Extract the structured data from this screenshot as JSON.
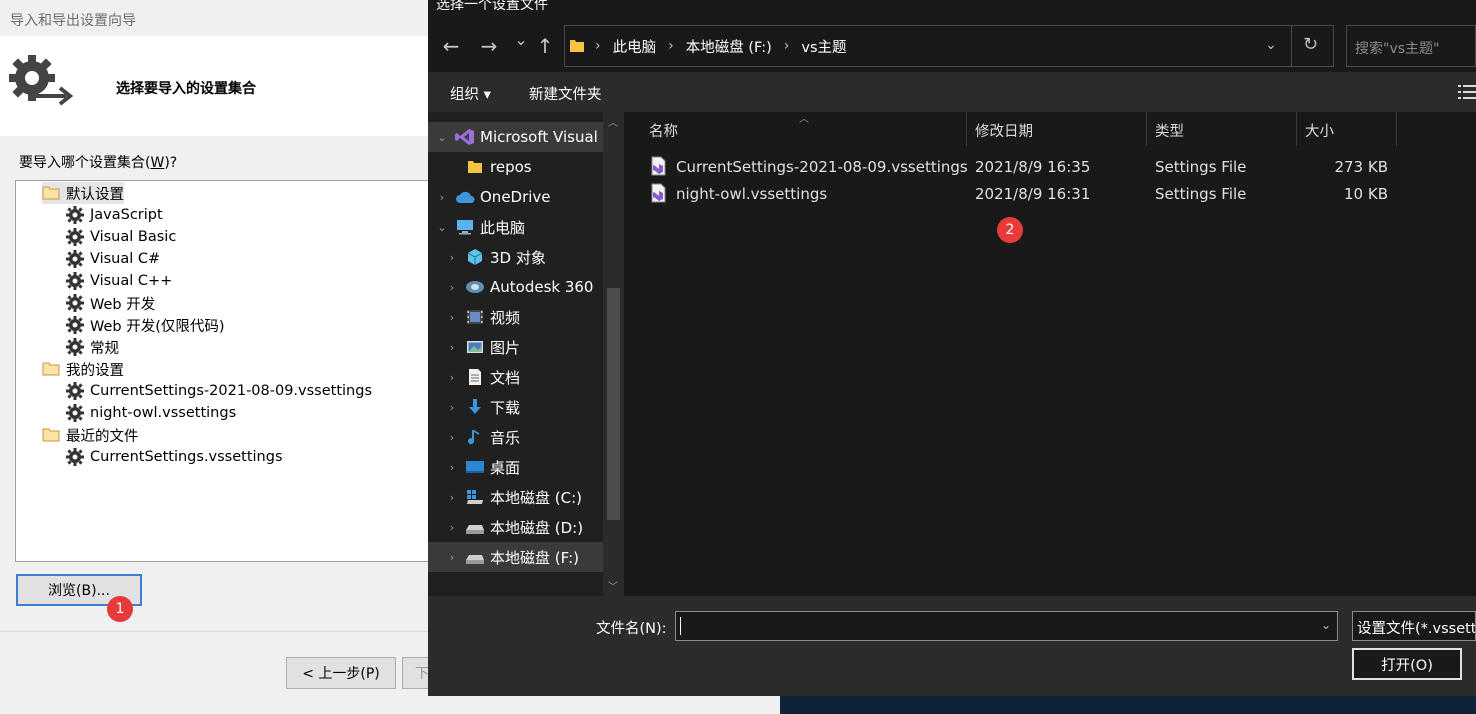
{
  "wizard": {
    "title": "导入和导出设置向导",
    "heading": "选择要导入的设置集合",
    "question_pre": "要导入哪个设置集合(",
    "question_key": "W",
    "question_post": ")?",
    "tree": [
      {
        "label": "默认设置",
        "type": "folder",
        "level": 0,
        "selected": true
      },
      {
        "label": "JavaScript",
        "type": "gear",
        "level": 1
      },
      {
        "label": "Visual Basic",
        "type": "gear",
        "level": 1
      },
      {
        "label": "Visual C#",
        "type": "gear",
        "level": 1
      },
      {
        "label": "Visual C++",
        "type": "gear",
        "level": 1
      },
      {
        "label": "Web 开发",
        "type": "gear",
        "level": 1
      },
      {
        "label": "Web 开发(仅限代码)",
        "type": "gear",
        "level": 1
      },
      {
        "label": "常规",
        "type": "gear",
        "level": 1
      },
      {
        "label": "我的设置",
        "type": "folder",
        "level": 0
      },
      {
        "label": "CurrentSettings-2021-08-09.vssettings",
        "type": "gear",
        "level": 1
      },
      {
        "label": "night-owl.vssettings",
        "type": "gear",
        "level": 1
      },
      {
        "label": "最近的文件",
        "type": "folder",
        "level": 0
      },
      {
        "label": "CurrentSettings.vssettings",
        "type": "gear",
        "level": 1
      }
    ],
    "browse_label": "浏览(B)...",
    "back_label": "< 上一步(P)",
    "next_label": "下"
  },
  "badges": {
    "one": "1",
    "two": "2"
  },
  "dialog": {
    "title": "选择一个设置文件",
    "nav": {
      "back": "←",
      "forward": "→",
      "recent": "⌄",
      "up": "↑",
      "refresh": "↻",
      "dropdown": "⌄"
    },
    "address": [
      "此电脑",
      "本地磁盘 (F:)",
      "vs主题"
    ],
    "search_placeholder": "搜索\"vs主题\"",
    "toolbar": {
      "organize": "组织 ▾",
      "new_folder": "新建文件夹"
    },
    "nav_pane": [
      {
        "label": "Microsoft Visual",
        "chev": "⌄",
        "icon": "vs-icon",
        "indent": 0,
        "selected": true
      },
      {
        "label": "repos",
        "chev": "",
        "icon": "folder-icon",
        "indent": 1
      },
      {
        "label": "OneDrive",
        "chev": "›",
        "icon": "cloud-icon",
        "indent": 0
      },
      {
        "label": "此电脑",
        "chev": "⌄",
        "icon": "pc-icon",
        "indent": 0
      },
      {
        "label": "3D 对象",
        "chev": "›",
        "icon": "cube-icon",
        "indent": 1
      },
      {
        "label": "Autodesk 360",
        "chev": "›",
        "icon": "autodesk-icon",
        "indent": 1
      },
      {
        "label": "视频",
        "chev": "›",
        "icon": "video-icon",
        "indent": 1
      },
      {
        "label": "图片",
        "chev": "›",
        "icon": "picture-icon",
        "indent": 1
      },
      {
        "label": "文档",
        "chev": "›",
        "icon": "document-icon",
        "indent": 1
      },
      {
        "label": "下载",
        "chev": "›",
        "icon": "download-icon",
        "indent": 1
      },
      {
        "label": "音乐",
        "chev": "›",
        "icon": "music-icon",
        "indent": 1
      },
      {
        "label": "桌面",
        "chev": "›",
        "icon": "desktop-icon",
        "indent": 1
      },
      {
        "label": "本地磁盘 (C:)",
        "chev": "›",
        "icon": "drive-c-icon",
        "indent": 1
      },
      {
        "label": "本地磁盘 (D:)",
        "chev": "›",
        "icon": "drive-icon",
        "indent": 1
      },
      {
        "label": "本地磁盘 (F:)",
        "chev": "›",
        "icon": "drive-icon",
        "indent": 1,
        "selected": true
      }
    ],
    "columns": [
      "名称",
      "修改日期",
      "类型",
      "大小"
    ],
    "files": [
      {
        "name": "CurrentSettings-2021-08-09.vssettings",
        "date": "2021/8/9 16:35",
        "type": "Settings File",
        "size": "273 KB"
      },
      {
        "name": "night-owl.vssettings",
        "date": "2021/8/9 16:31",
        "type": "Settings File",
        "size": "10 KB"
      }
    ],
    "filename_label": "文件名(N):",
    "filename_value": "",
    "filetype_value": "设置文件(*.vssettings)",
    "open_label": "打开(O)"
  }
}
